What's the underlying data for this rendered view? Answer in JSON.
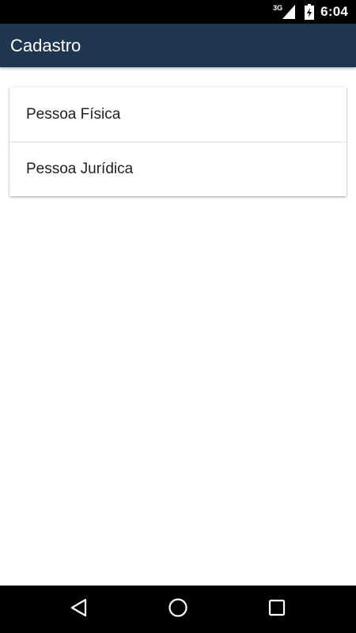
{
  "status_bar": {
    "network_label": "3G",
    "time": "6:04",
    "icons": [
      "signal-icon",
      "battery-charging-icon"
    ]
  },
  "app_bar": {
    "title": "Cadastro",
    "background_color": "#20354f"
  },
  "options": [
    {
      "label": "Pessoa Física"
    },
    {
      "label": "Pessoa Jurídica"
    }
  ],
  "nav_bar": {
    "icons": [
      "back-icon",
      "home-icon",
      "recent-apps-icon"
    ]
  }
}
